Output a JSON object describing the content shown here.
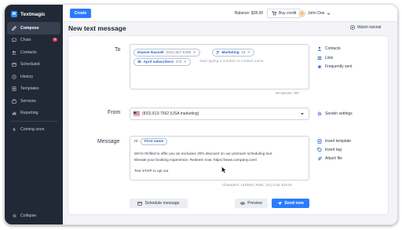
{
  "brand": {
    "name": "Textmagic"
  },
  "sidebar": {
    "items": [
      {
        "label": "Compose",
        "icon": "compose-icon",
        "active": true
      },
      {
        "label": "Chats",
        "icon": "chat-icon",
        "badge": "4"
      },
      {
        "label": "Contacts",
        "icon": "contacts-icon"
      },
      {
        "label": "Scheduled",
        "icon": "calendar-icon"
      },
      {
        "label": "History",
        "icon": "history-icon"
      },
      {
        "label": "Templates",
        "icon": "templates-icon"
      },
      {
        "label": "Services",
        "icon": "services-icon"
      },
      {
        "label": "Reporting",
        "icon": "reporting-icon"
      },
      {
        "label": "Coming soon",
        "icon": "bolt-icon"
      }
    ],
    "collapse_label": "Collapse"
  },
  "topbar": {
    "create_label": "Create",
    "balance": "Balance: $28.00",
    "buy_credit": "Buy credit",
    "user_initials": "J",
    "user_name": "John Doe"
  },
  "page": {
    "title": "New text message",
    "tutorial": "Watch tutorial"
  },
  "to": {
    "label": "To",
    "chips": [
      {
        "name": "Dianne Russell",
        "sub": "(632) 857-6398"
      },
      {
        "name": "Marketing",
        "sub": "18"
      },
      {
        "name": "April subscribers",
        "sub": "378"
      }
    ],
    "placeholder": "Start typing a number or contact name",
    "recipients": "Recipients: 397",
    "links": [
      "Contacts",
      "Lists",
      "Frequently sent"
    ]
  },
  "from": {
    "label": "From",
    "value": "(833) 813-7562 (USA marketing)",
    "link": "Sender settings"
  },
  "message": {
    "label": "Message",
    "hi": "Hi",
    "tag": "First name",
    "lines": [
      "We're thrilled to offer you an exclusive 20% discount on our premium scheduling tool.",
      "Elevate your booking experience. Redeem now: https://www.company.com/",
      "Text STOP to opt out"
    ],
    "counter": "Characters: 143/918  |  Parts: 1/6  |  Cost: $19.40",
    "links": [
      "Insert template",
      "Insert tag",
      "Attach file"
    ]
  },
  "actions": {
    "schedule": "Schedule message",
    "preview": "Preview",
    "send": "Send now"
  },
  "colors": {
    "accent": "#2a7cff",
    "sidebar": "#212936",
    "badge": "#e9485a"
  }
}
